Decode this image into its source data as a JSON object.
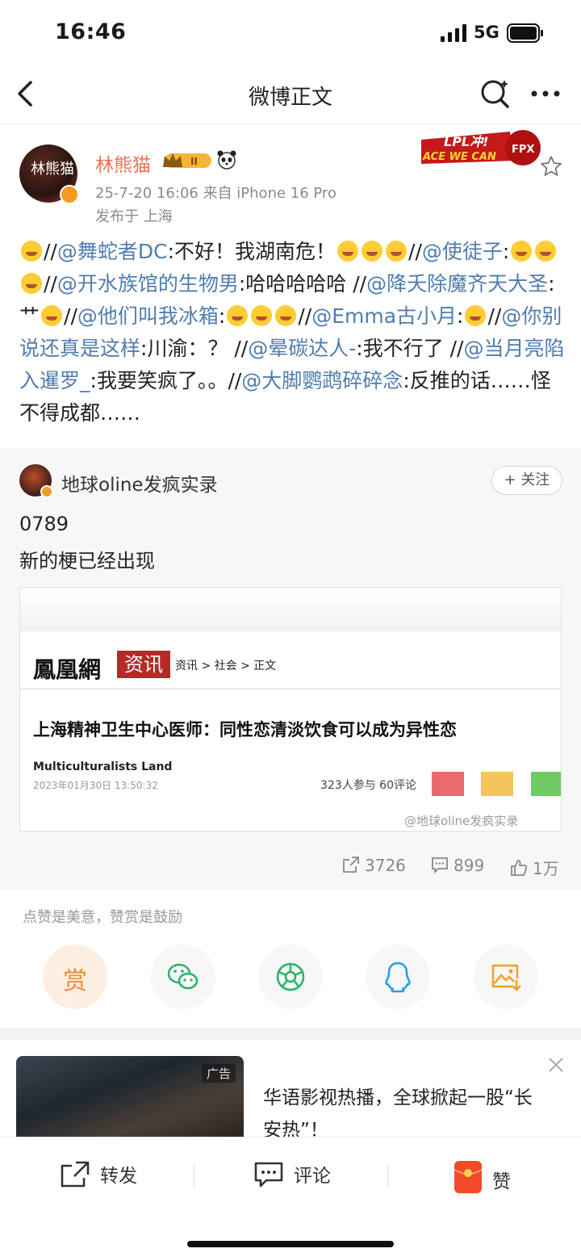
{
  "status": {
    "time": "16:46",
    "network": "5G"
  },
  "nav": {
    "title": "微博正文"
  },
  "author": {
    "avatar_text": "林熊猫",
    "name": "林熊猫",
    "level_badge": "II",
    "meta": "25-7-20 16:06  来自 iPhone 16 Pro",
    "location": "发布于 上海",
    "badge_top": "LPL冲!",
    "badge_bottom": "ACE WE CAN",
    "badge_team": "FPX"
  },
  "post": {
    "segments": [
      {
        "t": "emoji"
      },
      {
        "t": "text",
        "v": "//"
      },
      {
        "t": "at",
        "v": "@舞蛇者DC"
      },
      {
        "t": "text",
        "v": ":不好！我湖南危！"
      },
      {
        "t": "emoji"
      },
      {
        "t": "emoji"
      },
      {
        "t": "emoji"
      },
      {
        "t": "text",
        "v": "//"
      },
      {
        "t": "at",
        "v": "@使徒子"
      },
      {
        "t": "text",
        "v": ":"
      },
      {
        "t": "emoji"
      },
      {
        "t": "emoji"
      },
      {
        "t": "emoji"
      },
      {
        "t": "text",
        "v": "//"
      },
      {
        "t": "at",
        "v": "@开水族馆的生物男"
      },
      {
        "t": "text",
        "v": ":哈哈哈哈哈 //"
      },
      {
        "t": "at",
        "v": "@降夭除魔齐天大圣"
      },
      {
        "t": "text",
        "v": ":艹"
      },
      {
        "t": "emoji"
      },
      {
        "t": "text",
        "v": "//"
      },
      {
        "t": "at",
        "v": "@他们叫我冰箱"
      },
      {
        "t": "text",
        "v": ":"
      },
      {
        "t": "emoji"
      },
      {
        "t": "emoji"
      },
      {
        "t": "emoji"
      },
      {
        "t": "text",
        "v": "//"
      },
      {
        "t": "at",
        "v": "@Emma古小月"
      },
      {
        "t": "text",
        "v": ":"
      },
      {
        "t": "emoji"
      },
      {
        "t": "text",
        "v": "//"
      },
      {
        "t": "at",
        "v": "@你别说还真是这样"
      },
      {
        "t": "text",
        "v": ":川渝：？ //"
      },
      {
        "t": "at",
        "v": "@晕碳达人-"
      },
      {
        "t": "text",
        "v": ":我不行了 //"
      },
      {
        "t": "at",
        "v": "@当月亮陷入暹罗_"
      },
      {
        "t": "text",
        "v": ":我要笑疯了。。//"
      },
      {
        "t": "at",
        "v": "@大脚鹦鹉碎碎念"
      },
      {
        "t": "text",
        "v": ":反推的话……怪不得成都……"
      }
    ]
  },
  "retweet": {
    "avatar_text": "地球",
    "name": "地球oline发疯实录",
    "follow_label": "+ 关注",
    "line1": "0789",
    "line2": "新的梗已经出现",
    "image": {
      "site": "鳳凰網",
      "channel": "资讯",
      "breadcrumb": "资讯 > 社会 > 正文",
      "headline": "上海精神卫生中心医师：同性恋清淡饮食可以成为异性恋",
      "source": "Multiculturalists Land",
      "date": "2023年01月30日 13:50:32",
      "stats": "323人参与  60评论",
      "watermark": "@地球oline发疯实录"
    },
    "reposts": "3726",
    "comments": "899",
    "likes": "1万"
  },
  "reward_hint": "点赞是美意，赞赏是鼓励",
  "share": {
    "reward_label": "赏"
  },
  "ad": {
    "tag": "广告",
    "text": "华语影视热播，全球掀起一股“长安热”！"
  },
  "bottom": {
    "repost": "转发",
    "comment": "评论",
    "like": "赞"
  },
  "colors": {
    "accent": "#eb7350",
    "link": "#507daf",
    "reward": "#f48a30"
  }
}
